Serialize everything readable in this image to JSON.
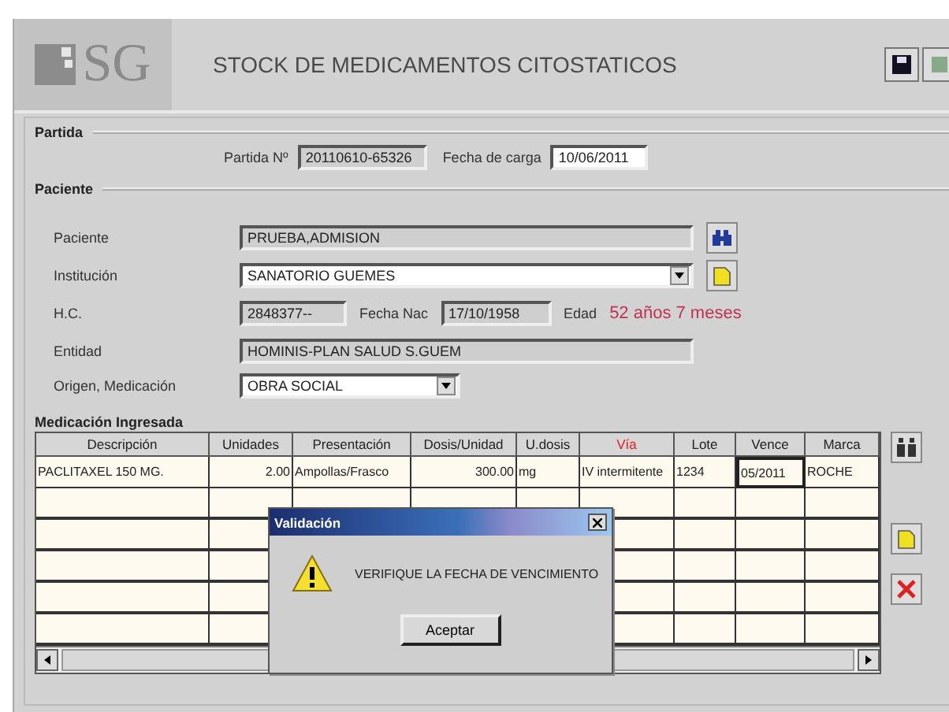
{
  "header": {
    "logo_text": "SG",
    "title": "STOCK DE MEDICAMENTOS CITOSTATICOS"
  },
  "partida": {
    "section": "Partida",
    "number_label": "Partida Nº",
    "number": "20110610-65326",
    "date_label": "Fecha de carga",
    "date": "10/06/2011"
  },
  "paciente": {
    "section": "Paciente",
    "patient_label": "Paciente",
    "patient": "PRUEBA,ADMISION",
    "institution_label": "Institución",
    "institution": "SANATORIO GUEMES",
    "hc_label": "H.C.",
    "hc": "2848377--",
    "birth_label": "Fecha Nac",
    "birth": "17/10/1958",
    "age_label": "Edad",
    "age": "52 años 7 meses",
    "entity_label": "Entidad",
    "entity": "HOMINIS-PLAN SALUD S.GUEM",
    "origin_label": "Origen, Medicación",
    "origin": "OBRA SOCIAL"
  },
  "medication": {
    "title": "Medicación Ingresada",
    "columns": [
      {
        "label": "Descripción",
        "highlighted": false
      },
      {
        "label": "Unidades",
        "highlighted": false
      },
      {
        "label": "Presentación",
        "highlighted": false
      },
      {
        "label": "Dosis/Unidad",
        "highlighted": false
      },
      {
        "label": "U.dosis",
        "highlighted": false
      },
      {
        "label": "Vía",
        "highlighted": true
      },
      {
        "label": "Lote",
        "highlighted": false
      },
      {
        "label": "Vence",
        "highlighted": false
      },
      {
        "label": "Marca",
        "highlighted": false
      }
    ],
    "rows": [
      {
        "cells": [
          {
            "text": "PACLITAXEL 150 MG.",
            "focused": false
          },
          {
            "text": "2.00",
            "focused": false
          },
          {
            "text": "Ampollas/Frasco",
            "focused": false
          },
          {
            "text": "300.00",
            "focused": false
          },
          {
            "text": "mg",
            "focused": false
          },
          {
            "text": "IV intermitente",
            "focused": false
          },
          {
            "text": "1234",
            "focused": false
          },
          {
            "text": "05/2011",
            "focused": true
          },
          {
            "text": "ROCHE",
            "focused": false
          }
        ]
      }
    ]
  },
  "dialog": {
    "title": "Validación",
    "message": "VERIFIQUE LA FECHA DE VENCIMIENTO",
    "button": "Aceptar"
  }
}
